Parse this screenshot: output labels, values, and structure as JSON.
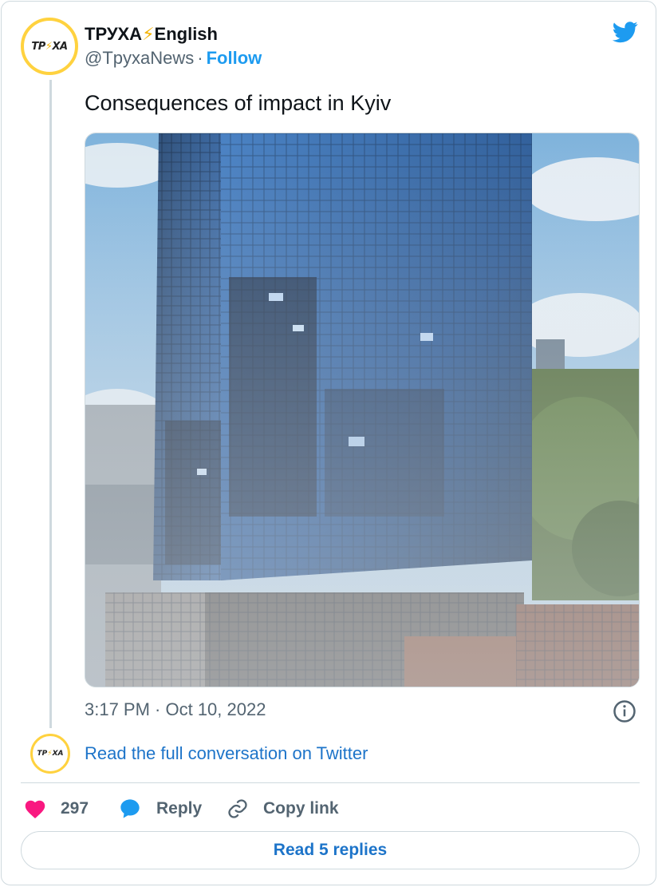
{
  "author": {
    "name": "ТРУХА",
    "name_emoji": "⚡",
    "name_suffix": "English",
    "handle": "@TpyxaNews",
    "separator": "·",
    "follow_label": "Follow",
    "avatar_text": "ТРУХА"
  },
  "tweet": {
    "text": "Consequences of impact in Kyiv",
    "timestamp": "3:17 PM · Oct 10, 2022"
  },
  "conversation_link": "Read the full conversation on Twitter",
  "actions": {
    "like_count": "297",
    "reply_label": "Reply",
    "copy_link_label": "Copy link"
  },
  "read_replies_label": "Read 5 replies",
  "icons": {
    "brand": "twitter-bird-icon",
    "info": "info-icon",
    "like": "heart-icon",
    "reply": "speech-bubble-icon",
    "copy": "link-icon"
  },
  "colors": {
    "accent": "#1d9bf0",
    "link": "#1d74c9",
    "like": "#f91880",
    "muted": "#536471",
    "brand_yellow": "#ffd23f"
  }
}
